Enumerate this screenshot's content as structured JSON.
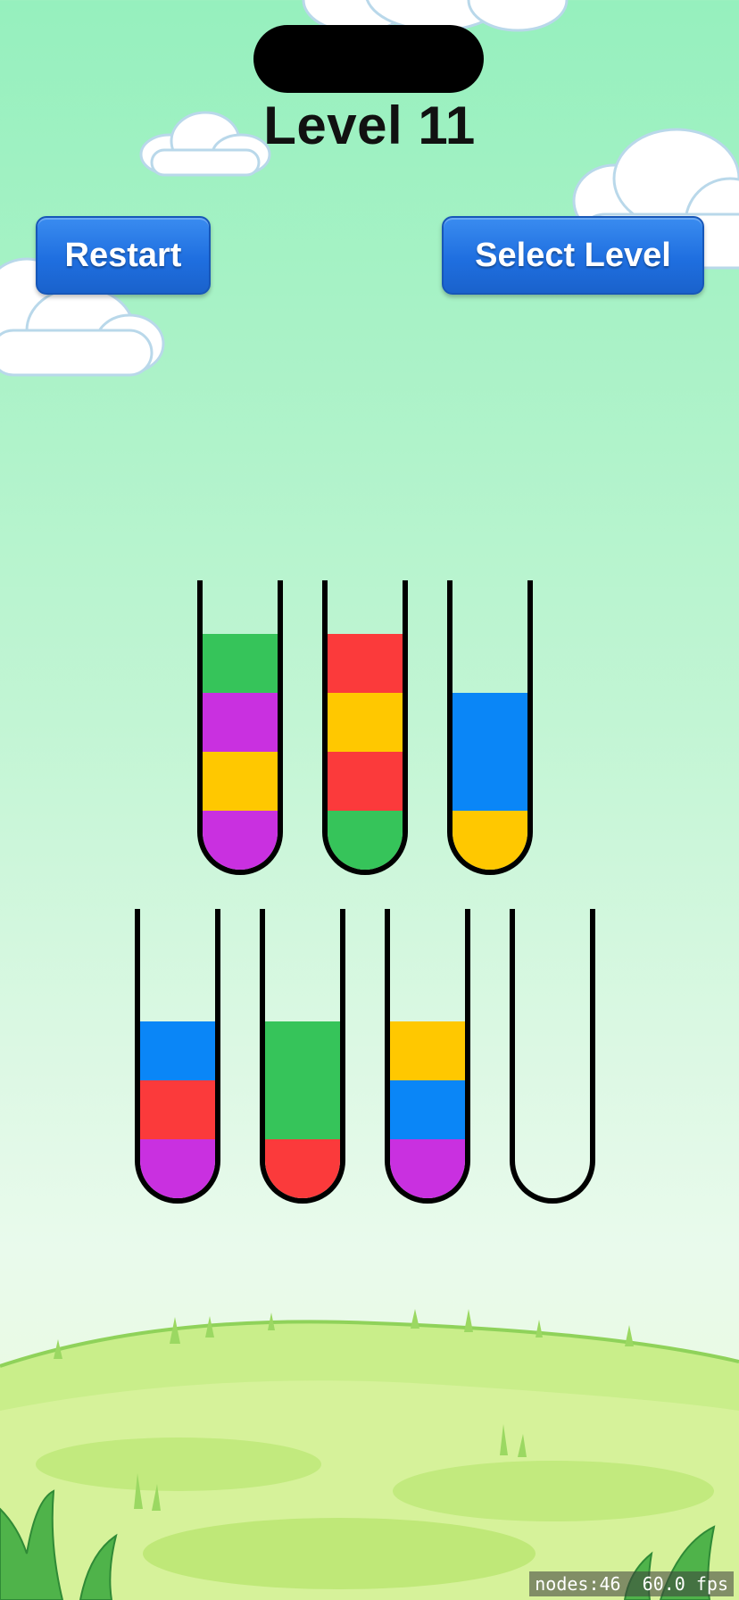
{
  "header": {
    "title": "Level 11"
  },
  "buttons": {
    "restart_label": "Restart",
    "select_level_label": "Select Level"
  },
  "colors": {
    "green": "#36c45a",
    "purple": "#c930e0",
    "yellow": "#ffc800",
    "red": "#fb3a3b",
    "blue": "#0a86f7"
  },
  "tubes": [
    {
      "layers_bottom_to_top": [
        "purple",
        "yellow",
        "purple",
        "green"
      ]
    },
    {
      "layers_bottom_to_top": [
        "green",
        "red",
        "yellow",
        "red"
      ]
    },
    {
      "layers_bottom_to_top": [
        "yellow",
        "blue",
        "blue"
      ]
    },
    {
      "layers_bottom_to_top": [
        "purple",
        "red",
        "blue"
      ]
    },
    {
      "layers_bottom_to_top": [
        "red",
        "green",
        "green"
      ]
    },
    {
      "layers_bottom_to_top": [
        "purple",
        "blue",
        "yellow"
      ]
    },
    {
      "layers_bottom_to_top": []
    }
  ],
  "debug": {
    "nodes_label": "nodes:46",
    "fps_label": "60.0 fps"
  }
}
